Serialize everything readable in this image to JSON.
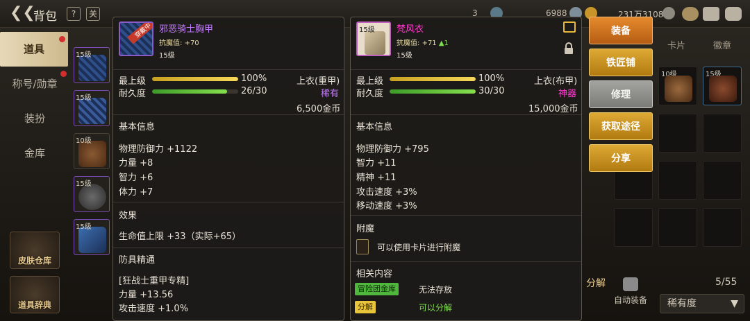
{
  "topbar": {
    "title": "背包",
    "icon1": "?",
    "icon2": "关",
    "res1": "6988",
    "res2": "231万3108",
    "res0": "3"
  },
  "left_tabs": [
    {
      "label": "道具",
      "active": true,
      "dot": true
    },
    {
      "label": "称号/勋章",
      "active": false,
      "dot": true
    },
    {
      "label": "装扮",
      "active": false,
      "dot": false
    },
    {
      "label": "金库",
      "active": false,
      "dot": false
    }
  ],
  "left_buttons": [
    "皮肤仓库",
    "道具辞典"
  ],
  "inventory_levels": [
    "15级",
    "15级",
    "10级",
    "15级",
    "15级"
  ],
  "right_tabs": [
    "卡片",
    "徽章"
  ],
  "grid_levels": [
    "10级",
    "15级"
  ],
  "page_count": "5/55",
  "sort": {
    "label": "稀有度"
  },
  "auto_equip": "自动装备",
  "dismantle": "分解",
  "actions": {
    "equip": "装备",
    "smith": "铁匠铺",
    "repair": "修理",
    "obtain": "获取途径",
    "share": "分享"
  },
  "item1": {
    "badge": "穿戴中",
    "level_badge": "",
    "name": "邪恶骑士胸甲",
    "name_color": "#c47cff",
    "resist_label": "抗魔值:",
    "resist_value": "+70",
    "resist_up": "",
    "level": "15级",
    "max_level_label": "最上级",
    "max_level_value": "100%",
    "max_level_pct": 100,
    "type": "上衣(重甲)",
    "durability_label": "耐久度",
    "durability_value": "26/30",
    "durability_pct": 86.7,
    "rarity": "稀有",
    "rarity_color": "#c47cff",
    "price": "6,500金币",
    "basic_title": "基本信息",
    "stats": [
      "物理防御力 +1122",
      "力量 +8",
      "智力 +6",
      "体力 +7"
    ],
    "effect_title": "效果",
    "effect": "生命值上限 +33（实际+65）",
    "mastery_title": "防具精通",
    "mastery_name": "[狂战士重甲专精]",
    "mastery_stats": [
      "力量 +13.56",
      "攻击速度 +1.0%"
    ]
  },
  "item2": {
    "level_badge": "15级",
    "name": "梵风衣",
    "name_color": "#ff3ccf",
    "resist_label": "抗魔值:",
    "resist_value": "+71",
    "resist_up": "▲1",
    "level": "15级",
    "max_level_label": "最上级",
    "max_level_value": "100%",
    "max_level_pct": 100,
    "type": "上衣(布甲)",
    "durability_label": "耐久度",
    "durability_value": "30/30",
    "durability_pct": 100,
    "rarity": "神器",
    "rarity_color": "#ff3ccf",
    "price": "15,000金币",
    "basic_title": "基本信息",
    "stats": [
      "物理防御力 +795",
      "智力 +11",
      "精神 +11",
      "攻击速度 +3%",
      "移动速度 +3%"
    ],
    "enchant_title": "附魔",
    "enchant_text": "可以使用卡片进行附魔",
    "related_title": "相关内容",
    "related_tag1": "冒险团金库",
    "related_text1": "无法存放",
    "related_tag2": "分解",
    "related_text2": "可以分解"
  }
}
